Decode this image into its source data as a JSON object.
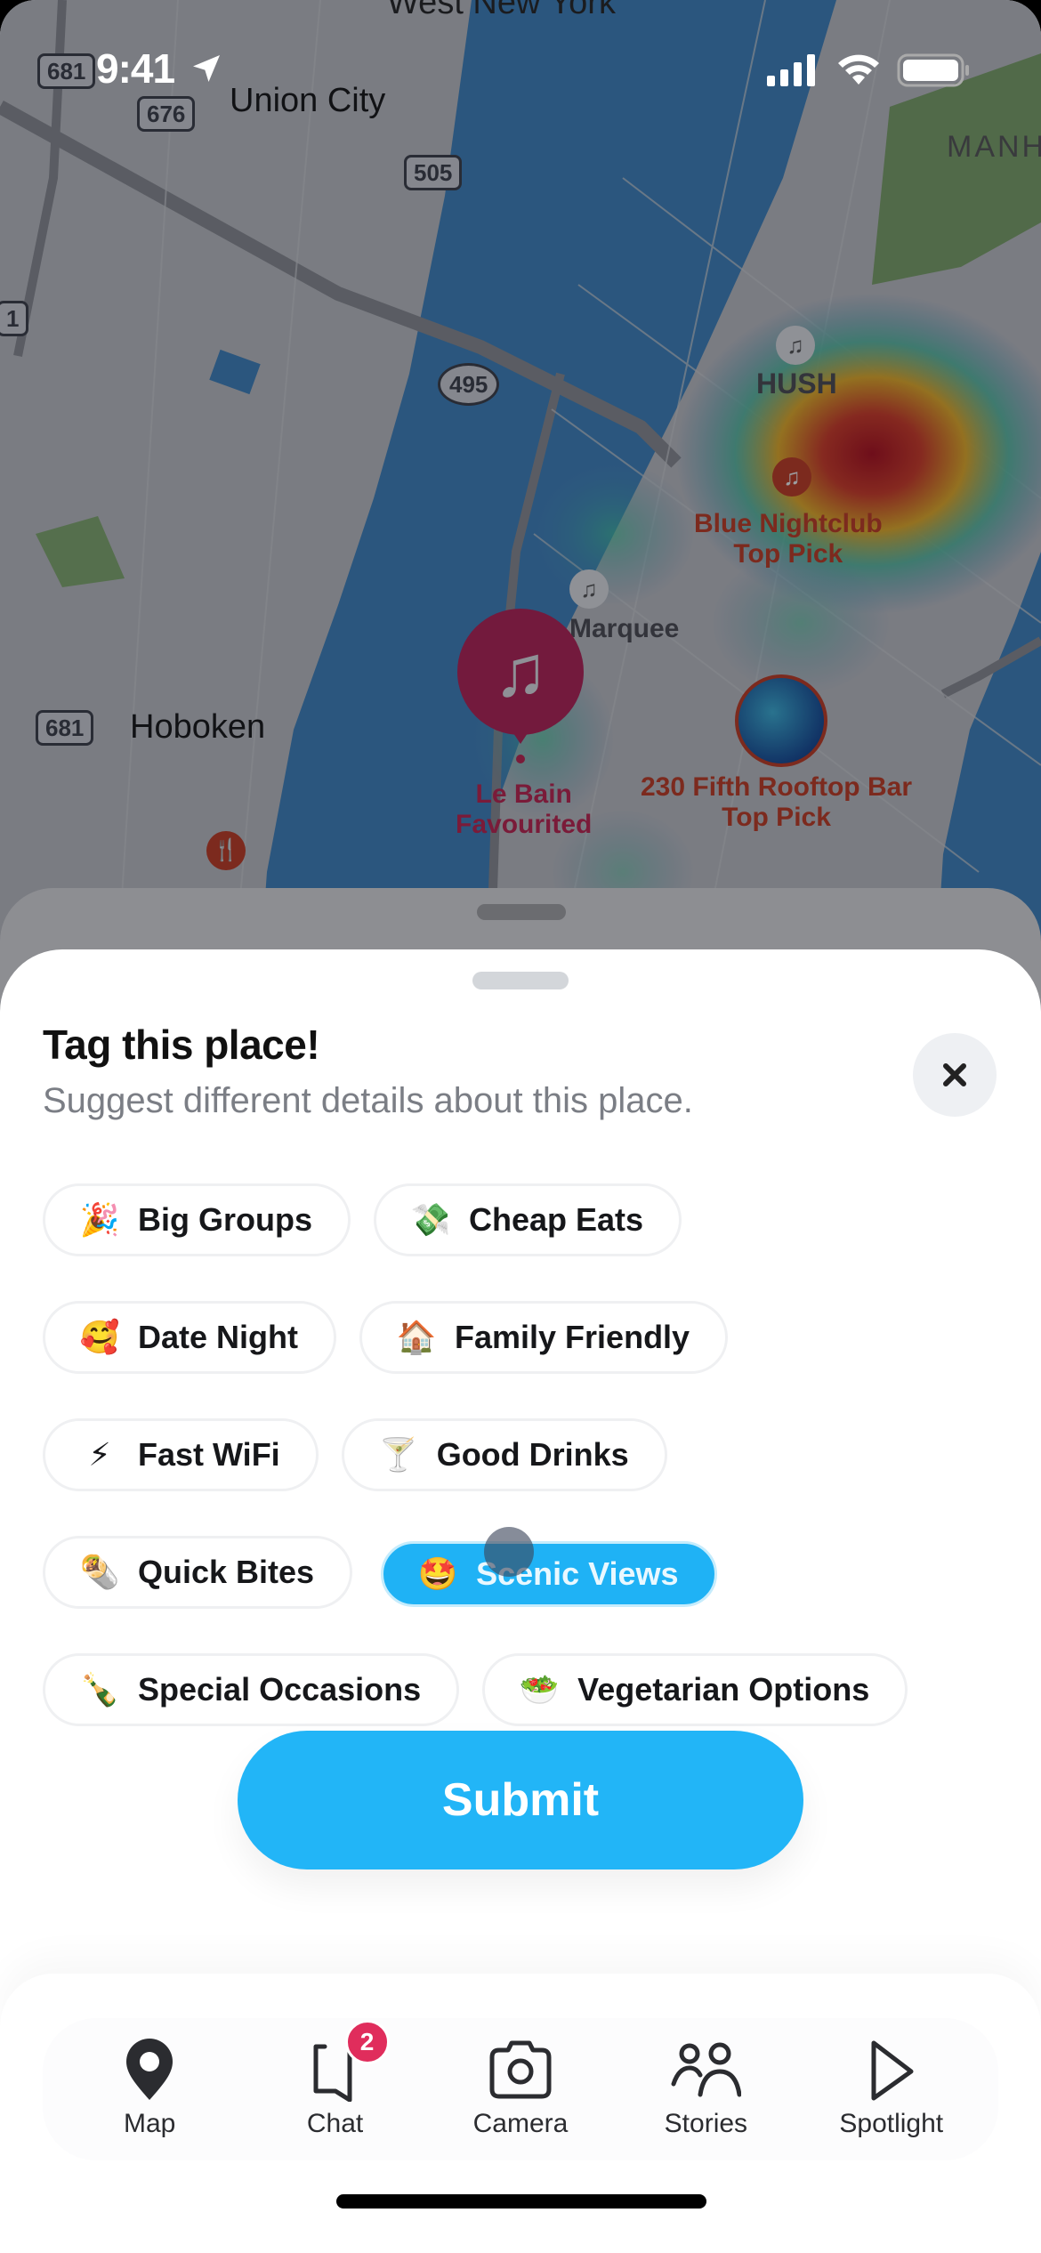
{
  "status_bar": {
    "time": "9:41",
    "icons": [
      "location-arrow-icon",
      "cellular-signal-icon",
      "wifi-icon",
      "battery-icon"
    ]
  },
  "map": {
    "area_labels": {
      "west_new_york": "West New York",
      "union_city": "Union City",
      "hoboken": "Hoboken",
      "manhattan": "MANH"
    },
    "route_shields": {
      "r681_top": "681",
      "r676": "676",
      "r505": "505",
      "r1": "1",
      "r495": "495",
      "r681_hoboken": "681"
    },
    "places": {
      "hush": "HUSH",
      "marquee": "Marquee",
      "blue_nightclub": {
        "name": "Blue Nightclub",
        "tag": "Top Pick"
      },
      "le_bain": {
        "name": "Le Bain",
        "tag": "Favourited"
      },
      "rooftop_bar": {
        "name": "230 Fifth Rooftop Bar",
        "tag": "Top Pick"
      }
    },
    "heatmap_colors": {
      "hot": "#b00010",
      "warm": "#f2b21c",
      "cool": "#3fc2a0"
    }
  },
  "sheet": {
    "title": "Tag this place!",
    "subtitle": "Suggest different details about this place.",
    "close_icon": "close-icon",
    "chip_rows": [
      [
        {
          "emoji": "🎉",
          "label": "Big Groups",
          "selected": false
        },
        {
          "emoji": "💸",
          "label": "Cheap Eats",
          "selected": false
        }
      ],
      [
        {
          "emoji": "🥰",
          "label": "Date Night",
          "selected": false
        },
        {
          "emoji": "🏠",
          "label": "Family Friendly",
          "selected": false
        }
      ],
      [
        {
          "emoji": "⚡",
          "label": "Fast WiFi",
          "selected": false
        },
        {
          "emoji": "🍸",
          "label": "Good Drinks",
          "selected": false
        }
      ],
      [
        {
          "emoji": "🌯",
          "label": "Quick Bites",
          "selected": false
        },
        {
          "emoji": "🤩",
          "label": "Scenic Views",
          "selected": true
        }
      ],
      [
        {
          "emoji": "🍾",
          "label": "Special Occasions",
          "selected": false
        },
        {
          "emoji": "🥗",
          "label": "Vegetarian Options",
          "selected": false
        }
      ]
    ],
    "submit_label": "Submit",
    "accent_color": "#22b5f7"
  },
  "nav": {
    "items": [
      {
        "label": "Map",
        "icon": "map-pin-icon"
      },
      {
        "label": "Chat",
        "icon": "chat-bubble-icon",
        "badge": "2"
      },
      {
        "label": "Camera",
        "icon": "camera-icon"
      },
      {
        "label": "Stories",
        "icon": "stories-people-icon"
      },
      {
        "label": "Spotlight",
        "icon": "spotlight-play-icon"
      }
    ],
    "badge_color": "#e02d5c"
  }
}
